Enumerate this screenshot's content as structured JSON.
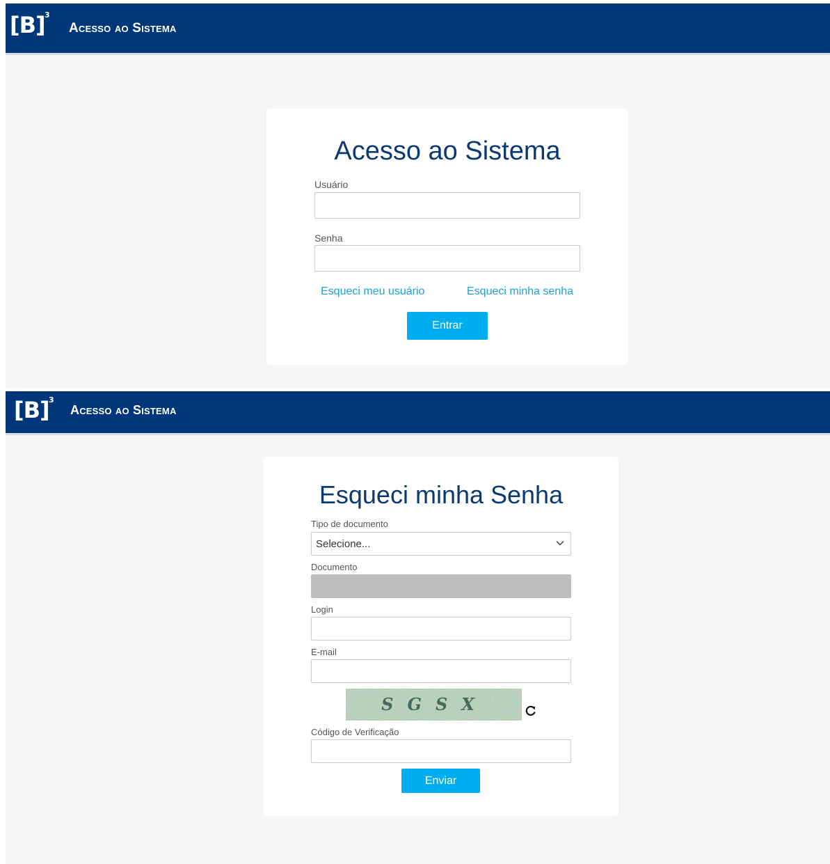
{
  "screens": [
    {
      "header": {
        "logo_letter": "B",
        "logo_sup": "3",
        "title": "Acesso ao Sistema"
      },
      "card": {
        "title": "Acesso ao Sistema",
        "user_label": "Usuário",
        "password_label": "Senha",
        "forgot_user": "Esqueci meu usuário",
        "forgot_password": "Esqueci minha senha",
        "submit": "Entrar"
      }
    },
    {
      "header": {
        "logo_letter": "B",
        "logo_sup": "3",
        "title": "Acesso ao Sistema"
      },
      "card": {
        "title": "Esqueci minha Senha",
        "doc_type_label": "Tipo de documento",
        "doc_type_selected": "Selecione...",
        "document_label": "Documento",
        "login_label": "Login",
        "email_label": "E-mail",
        "captcha_text": "SGSX",
        "code_label": "Código de Verificação",
        "submit": "Enviar"
      }
    }
  ],
  "colors": {
    "header": "#00377a",
    "title": "#0b3a73",
    "accent": "#00aeef",
    "link": "#1aa3d9",
    "background": "#f6f6f6"
  },
  "icons": {
    "chevron": "chevron-down-icon",
    "refresh": "refresh-icon"
  }
}
